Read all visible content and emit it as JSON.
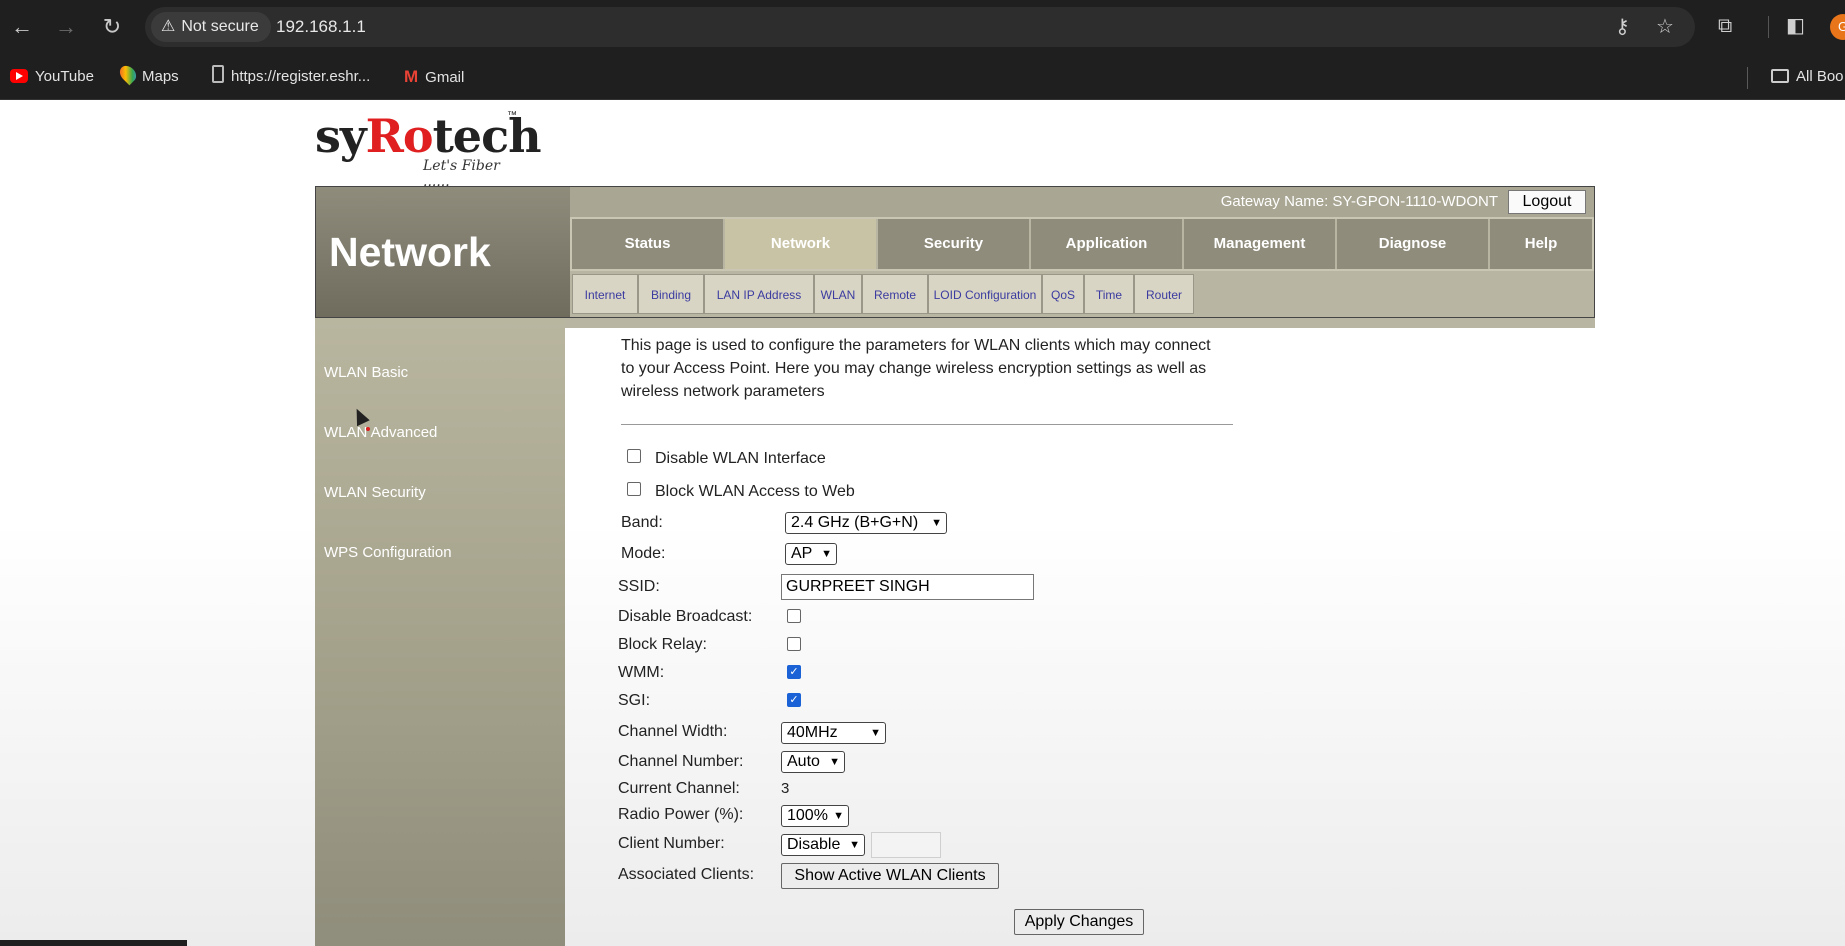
{
  "browser": {
    "security_label": "Not secure",
    "url": "192.168.1.1",
    "bookmarks": [
      {
        "label": "YouTube",
        "icon": "youtube-icon"
      },
      {
        "label": "Maps",
        "icon": "maps-icon"
      },
      {
        "label": "https://register.eshr...",
        "icon": "bookmark-page-icon"
      },
      {
        "label": "Gmail",
        "icon": "gmail-icon"
      }
    ],
    "all_bookmarks_label": "All Boo"
  },
  "logo": {
    "brand": "syRotech",
    "tagline": "Let's Fiber ......",
    "tm": "TM"
  },
  "header": {
    "section_title": "Network",
    "gateway_name": "Gateway Name: SY-GPON-1110-WDONT",
    "logout_label": "Logout",
    "main_tabs": [
      "Status",
      "Network",
      "Security",
      "Application",
      "Management",
      "Diagnose",
      "Help"
    ],
    "active_tab": "Network",
    "sub_tabs": [
      "Internet",
      "Binding",
      "LAN IP Address",
      "WLAN",
      "Remote",
      "LOID Configuration",
      "QoS",
      "Time",
      "Router"
    ]
  },
  "sidebar": {
    "items": [
      "WLAN Basic",
      "WLAN Advanced",
      "WLAN Security",
      "WPS Configuration"
    ]
  },
  "form": {
    "description": "This page is used to configure the parameters for WLAN clients which may connect to your Access Point. Here you may change wireless encryption settings as well as wireless network parameters",
    "disable_wlan_label": "Disable WLAN Interface",
    "disable_wlan_checked": false,
    "block_web_label": "Block WLAN Access to Web",
    "block_web_checked": false,
    "band_label": "Band:",
    "band_value": "2.4 GHz (B+G+N)",
    "mode_label": "Mode:",
    "mode_value": "AP",
    "ssid_label": "SSID:",
    "ssid_value": "GURPREET SINGH",
    "disable_broadcast_label": "Disable Broadcast:",
    "disable_broadcast_checked": false,
    "block_relay_label": "Block Relay:",
    "block_relay_checked": false,
    "wmm_label": "WMM:",
    "wmm_checked": true,
    "sgi_label": "SGI:",
    "sgi_checked": true,
    "channel_width_label": "Channel Width:",
    "channel_width_value": "40MHz",
    "channel_number_label": "Channel Number:",
    "channel_number_value": "Auto",
    "current_channel_label": "Current Channel:",
    "current_channel_value": "3",
    "radio_power_label": "Radio Power (%):",
    "radio_power_value": "100%",
    "client_number_label": "Client Number:",
    "client_number_value": "Disable",
    "associated_clients_label": "Associated Clients:",
    "show_clients_label": "Show Active WLAN Clients",
    "apply_label": "Apply Changes"
  }
}
